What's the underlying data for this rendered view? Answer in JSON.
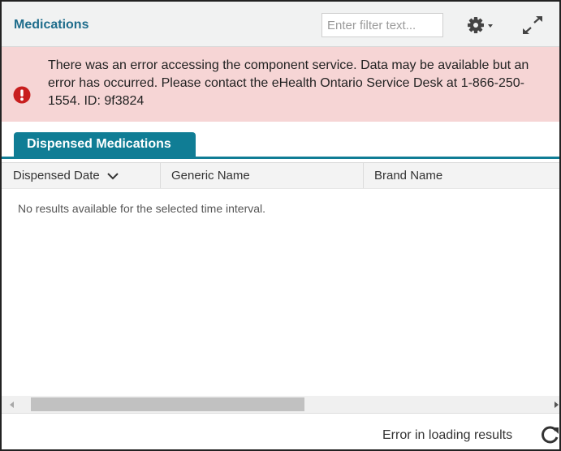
{
  "header": {
    "title": "Medications",
    "filter_placeholder": "Enter filter text...",
    "settings_icon": "gear-icon",
    "expand_icon": "expand-icon"
  },
  "alert": {
    "icon": "exclamation-circle-icon",
    "message": "There was an error accessing the component service. Data may be available but an error has occurred. Please contact the eHealth Ontario Service Desk at 1-866-250-1554. ID: 9f3824"
  },
  "tabs": [
    {
      "label": "Dispensed Medications",
      "active": true
    }
  ],
  "table": {
    "columns": [
      "Dispensed Date",
      "Generic Name",
      "Brand Name"
    ],
    "sort_icon": "chevron-down-icon",
    "empty_message": "No results available for the selected time interval."
  },
  "footer": {
    "status": "Error in loading results",
    "refresh_icon": "refresh-icon"
  },
  "colors": {
    "title": "#1f6d8c",
    "tab": "#107d95",
    "alert_bg": "#f6d5d5",
    "alert_icon": "#c81e1e"
  }
}
